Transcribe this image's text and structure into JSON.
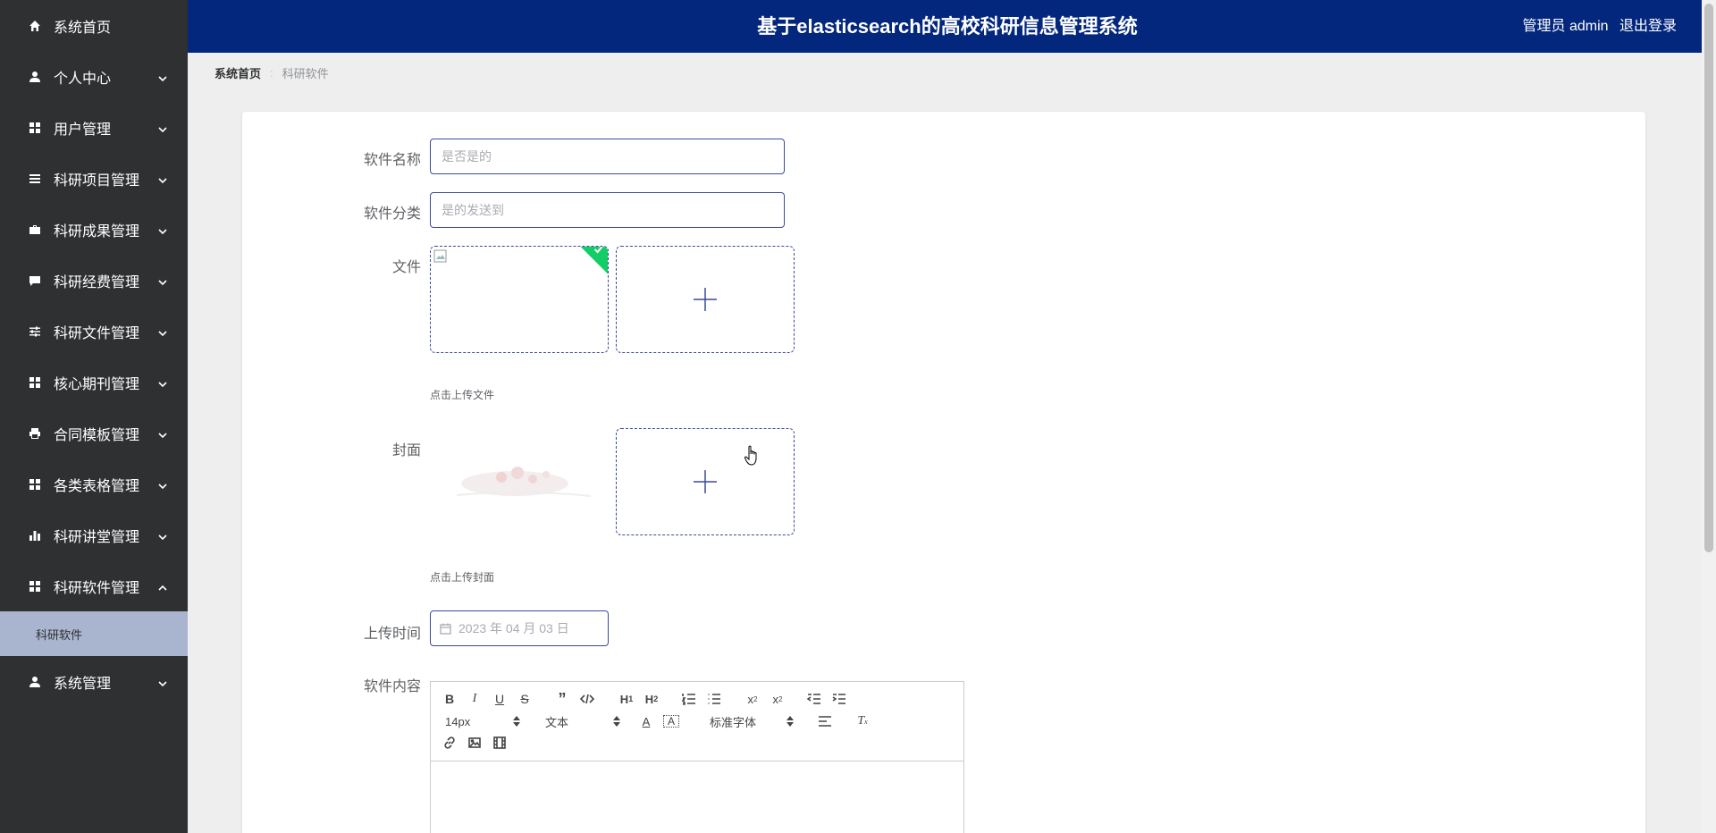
{
  "sidebar": {
    "items": [
      {
        "label": "系统首页",
        "icon": "home-icon",
        "has_chevron": false
      },
      {
        "label": "个人中心",
        "icon": "user-icon",
        "has_chevron": true
      },
      {
        "label": "用户管理",
        "icon": "grid-icon",
        "has_chevron": true
      },
      {
        "label": "科研项目管理",
        "icon": "list-icon",
        "has_chevron": true
      },
      {
        "label": "科研成果管理",
        "icon": "briefcase-icon",
        "has_chevron": true
      },
      {
        "label": "科研经费管理",
        "icon": "comment-icon",
        "has_chevron": true
      },
      {
        "label": "科研文件管理",
        "icon": "sliders-icon",
        "has_chevron": true
      },
      {
        "label": "核心期刊管理",
        "icon": "grid-icon",
        "has_chevron": true
      },
      {
        "label": "合同模板管理",
        "icon": "printer-icon",
        "has_chevron": true
      },
      {
        "label": "各类表格管理",
        "icon": "grid-icon",
        "has_chevron": true
      },
      {
        "label": "科研讲堂管理",
        "icon": "bar-chart-icon",
        "has_chevron": true
      },
      {
        "label": "科研软件管理",
        "icon": "grid-icon",
        "has_chevron": true,
        "expanded": true
      }
    ],
    "sub_item": "科研软件",
    "last_item": {
      "label": "系统管理",
      "icon": "user-icon",
      "has_chevron": true
    }
  },
  "header": {
    "title": "基于elasticsearch的高校科研信息管理系统",
    "user_role": "管理员 admin",
    "logout": "退出登录",
    "bg_color": "#03277d"
  },
  "breadcrumb": {
    "home": "系统首页",
    "separator": ":",
    "current": "科研软件"
  },
  "form": {
    "name_label": "软件名称",
    "name_value": "是否是的",
    "category_label": "软件分类",
    "category_value": "是的发送到",
    "file_label": "文件",
    "file_tip": "点击上传文件",
    "cover_label": "封面",
    "cover_tip": "点击上传封面",
    "time_label": "上传时间",
    "time_value": "2023 年 04 月 03 日",
    "content_label": "软件内容"
  },
  "editor": {
    "size_picker": "14px",
    "header_picker": "文本",
    "font_picker": "标准字体"
  },
  "colors": {
    "sidebar_bg": "#2f3032",
    "sub_item_bg": "#a9b4ce",
    "accent": "#3a4a9a",
    "success": "#13ce66"
  }
}
